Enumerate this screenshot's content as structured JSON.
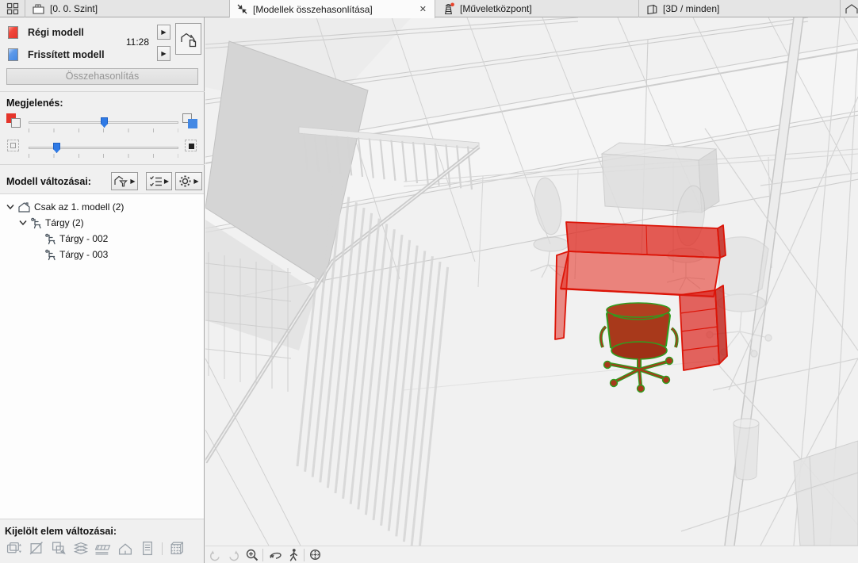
{
  "colors": {
    "old_model_red": "#e5352b",
    "new_model_blue": "#4388e4",
    "change_stroke_red": "#dc1407",
    "change_stroke_green": "#2f9e1f",
    "notification_dot": "#e8432b"
  },
  "tab_bar": {
    "tabs": [
      {
        "label": "[0. 0. Szint]"
      },
      {
        "label": "[Modellek összehasonlítása]",
        "close": "✕"
      },
      {
        "label": "[Műveletközpont]"
      },
      {
        "label": "[3D / minden]"
      }
    ]
  },
  "sidebar": {
    "old_model_label": "Régi modell",
    "new_model_label": "Frissített modell",
    "time": "11:28",
    "compare_button": "Összehasonlítás",
    "appearance_label": "Megjelenés:",
    "appearance": {
      "slider1_pct": 51,
      "slider2_pct": 19
    },
    "changes_label": "Modell változásai:",
    "tree": [
      {
        "label": "Csak az 1. modell (2)"
      },
      {
        "label": "Tárgy (2)"
      },
      {
        "label": "Tárgy - 002"
      },
      {
        "label": "Tárgy - 003"
      }
    ],
    "selected_label": "Kijelölt elem változásai:"
  }
}
